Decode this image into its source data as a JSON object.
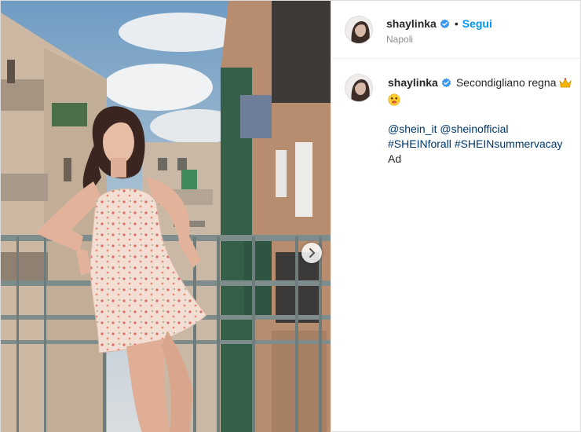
{
  "header": {
    "username": "shaylinka",
    "separator": "•",
    "follow_label": "Segui",
    "location": "Napoli",
    "verified_icon": "verified-badge-icon",
    "verified_color": "#3897f0"
  },
  "caption": {
    "username": "shaylinka",
    "text": "Secondigliano regna",
    "emojis": [
      "crown-emoji",
      "face-emoji"
    ],
    "mentions": [
      "@shein_it",
      "@sheinofficial"
    ],
    "hashtags": [
      "#SHEINforall",
      "#SHEINsummervacay"
    ],
    "ad_label": "Ad"
  },
  "media": {
    "description_icon": "photo",
    "next_icon": "chevron-right-icon"
  },
  "colors": {
    "link": "#00376b",
    "follow": "#0095f6",
    "muted": "#8e8e8e"
  }
}
